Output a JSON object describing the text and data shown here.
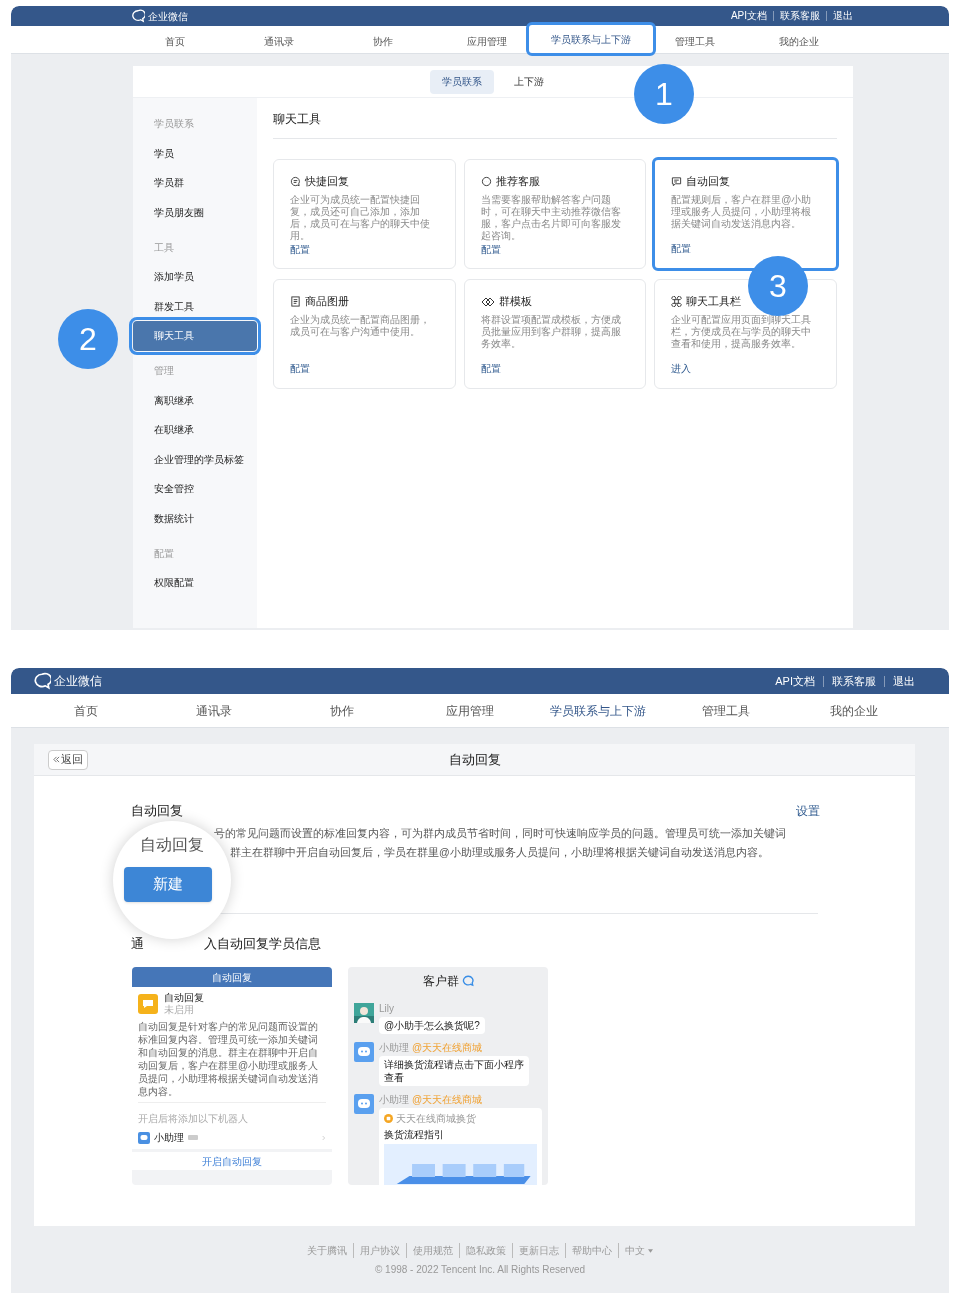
{
  "top_screen": {
    "header": {
      "brand": "企业微信",
      "links": [
        "API文档",
        "联系客服",
        "退出"
      ]
    },
    "nav": [
      {
        "label": "首页",
        "selected": false,
        "highlighted": false
      },
      {
        "label": "通讯录",
        "selected": false,
        "highlighted": false
      },
      {
        "label": "协作",
        "selected": false,
        "highlighted": false
      },
      {
        "label": "应用管理",
        "selected": false,
        "highlighted": false
      },
      {
        "label": "学员联系与上下游",
        "selected": true,
        "highlighted": true
      },
      {
        "label": "管理工具",
        "selected": false,
        "highlighted": false
      },
      {
        "label": "我的企业",
        "selected": false,
        "highlighted": false
      }
    ],
    "subtabs": [
      {
        "label": "学员联系",
        "selected": true
      },
      {
        "label": "上下游",
        "selected": false
      }
    ],
    "sidebar": [
      {
        "kind": "heading",
        "label": "学员联系"
      },
      {
        "kind": "item",
        "label": "学员",
        "selected": false,
        "highlighted": false
      },
      {
        "kind": "item",
        "label": "学员群",
        "selected": false,
        "highlighted": false
      },
      {
        "kind": "item",
        "label": "学员朋友圈",
        "selected": false,
        "highlighted": false
      },
      {
        "kind": "heading",
        "label": "工具"
      },
      {
        "kind": "item",
        "label": "添加学员",
        "selected": false,
        "highlighted": false
      },
      {
        "kind": "item",
        "label": "群发工具",
        "selected": false,
        "highlighted": false
      },
      {
        "kind": "item",
        "label": "聊天工具",
        "selected": true,
        "highlighted": true
      },
      {
        "kind": "heading",
        "label": "管理"
      },
      {
        "kind": "item",
        "label": "离职继承",
        "selected": false,
        "highlighted": false
      },
      {
        "kind": "item",
        "label": "在职继承",
        "selected": false,
        "highlighted": false
      },
      {
        "kind": "item",
        "label": "企业管理的学员标签",
        "selected": false,
        "highlighted": false
      },
      {
        "kind": "item",
        "label": "安全管控",
        "selected": false,
        "highlighted": false
      },
      {
        "kind": "item",
        "label": "数据统计",
        "selected": false,
        "highlighted": false
      },
      {
        "kind": "heading",
        "label": "配置"
      },
      {
        "kind": "item",
        "label": "权限配置",
        "selected": false,
        "highlighted": false
      }
    ],
    "section_title": "聊天工具",
    "cards": [
      {
        "kind": "quick_reply",
        "title": "快捷回复",
        "description": "企业可为成员统一配置快捷回复，成员还可自己添加，添加后，成员可在与客户的聊天中使用。",
        "action": "配置",
        "highlighted": false
      },
      {
        "kind": "service",
        "title": "推荐客服",
        "description": "当需要客服帮助解答客户问题时，可在聊天中主动推荐微信客服，客户点击名片即可向客服发起咨询。",
        "action": "配置",
        "highlighted": false
      },
      {
        "kind": "auto_reply",
        "title": "自动回复",
        "description": "配置规则后，客户在群里@小助理或服务人员提问，小助理将根据关键词自动发送消息内容。",
        "action": "配置",
        "highlighted": true
      },
      {
        "kind": "catalog",
        "title": "商品图册",
        "description": "企业为成员统一配置商品图册，成员可在与客户沟通中使用。",
        "action": "配置",
        "highlighted": false
      },
      {
        "kind": "template",
        "title": "群模板",
        "description": "将群设置项配置成模板，方便成员批量应用到客户群聊，提高服务效率。",
        "action": "配置",
        "highlighted": false
      },
      {
        "kind": "toolbar",
        "title": "聊天工具栏",
        "description": "企业可配置应用页面到聊天工具栏，方便成员在与学员的聊天中查看和使用，提高服务效率。",
        "action": "进入",
        "highlighted": false
      }
    ]
  },
  "bottom_screen": {
    "header": {
      "brand": "企业微信",
      "links": [
        "API文档",
        "联系客服",
        "退出"
      ]
    },
    "nav": [
      {
        "label": "首页",
        "selected": false
      },
      {
        "label": "通讯录",
        "selected": false
      },
      {
        "label": "协作",
        "selected": false
      },
      {
        "label": "应用管理",
        "selected": false
      },
      {
        "label": "学员联系与上下游",
        "selected": true
      },
      {
        "label": "管理工具",
        "selected": false
      },
      {
        "label": "我的企业",
        "selected": false
      }
    ],
    "back_button": "返回",
    "page_title": "自动回复",
    "section_title": "自动回复",
    "settings_link": "设置",
    "description_lines": [
      "号的常见问题而设置的标准回复内容，可为群内成员节省时间，同时可快速响应学员的问题。管理员可统一添加关键词",
      "群主在群聊中开启自动回复后，学员在群里@小助理或服务人员提问，小助理将根据关键词自动发送消息内容。"
    ],
    "magnifier": {
      "text": "自动回复",
      "button": "新建"
    },
    "preview_heading": [
      "通",
      "入自动回复学员信息"
    ],
    "app_preview": {
      "header": "自动回复",
      "app_name": "自动回复",
      "app_status": "未启用",
      "description": "自动回复是针对客户的常见问题而设置的标准回复内容。管理员可统一添加关键词和自动回复的消息。群主在群聊中开启自动回复后，客户在群里@小助理或服务人员提问，小助理将根据关键词自动发送消息内容。",
      "robot_hint": "开启后将添加以下机器人",
      "robot_name": "小助理",
      "button": "开启自动回复"
    },
    "chat_preview": {
      "title": "客户群",
      "messages": [
        {
          "kind": "text",
          "sender": "Lily",
          "text": "@小助手怎么换货呢?"
        },
        {
          "kind": "text",
          "sender": "小助理",
          "sender_tag": "@天天在线商城",
          "text": "详细换货流程请点击下面小程序查看"
        },
        {
          "kind": "mini_program",
          "sender": "小助理",
          "sender_tag": "@天天在线商城",
          "source": "天天在线商城换货",
          "text": "换货流程指引"
        }
      ]
    }
  },
  "footer": {
    "links": [
      "关于腾讯",
      "用户协议",
      "使用规范",
      "隐私政策",
      "更新日志",
      "帮助中心"
    ],
    "language": "中文",
    "copyright": "© 1998 - 2022 Tencent Inc. All Rights Reserved"
  },
  "callouts": [
    {
      "number": "1"
    },
    {
      "number": "2"
    },
    {
      "number": "3"
    }
  ]
}
